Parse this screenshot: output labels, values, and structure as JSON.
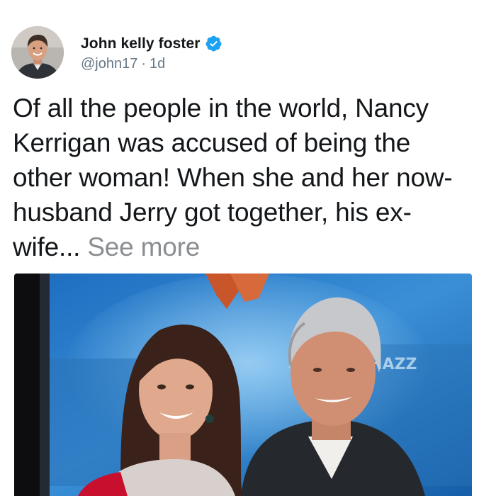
{
  "tweet": {
    "author": {
      "display_name": "John kelly foster",
      "handle": "@john17",
      "separator": "·",
      "time": "1d",
      "verified": true,
      "verified_icon": "verified-badge-icon",
      "avatar_icon": "avatar"
    },
    "text_lines": [
      "Of all the people in the world, Nancy",
      "Kerrigan was accused of being the",
      "other woman! When she and her now-",
      "husband Jerry got together, his ex-",
      "wife... "
    ],
    "see_more": "See more",
    "media": {
      "kind": "photo",
      "description_icon": "photo-couple-image",
      "backdrop_text": "CHAZZ"
    }
  },
  "colors": {
    "text": "#14171a",
    "secondary": "#657786",
    "see_more": "#8a8d91",
    "verified_blue": "#1da1f2",
    "background": "#ffffff"
  }
}
